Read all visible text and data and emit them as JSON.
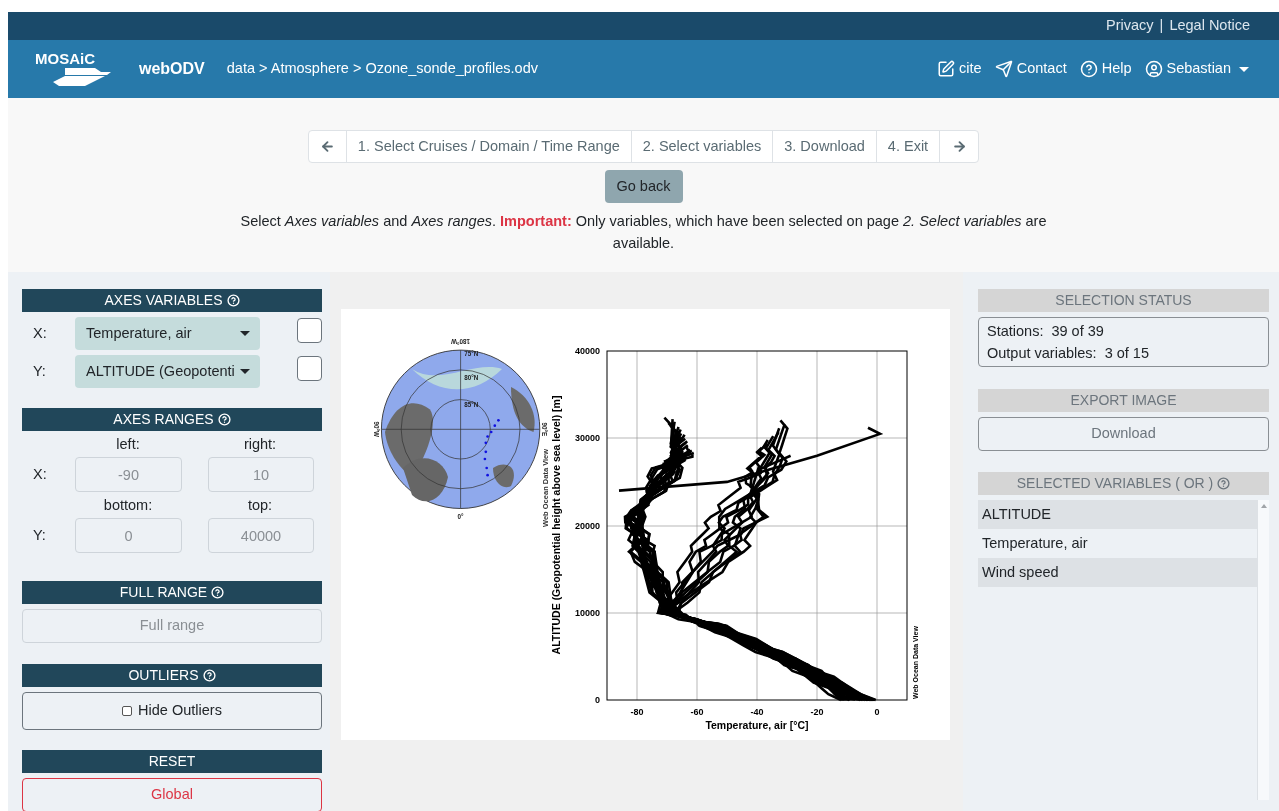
{
  "top_links": {
    "privacy": "Privacy",
    "separator": "|",
    "legal": "Legal Notice"
  },
  "brand": {
    "logo": "MOSAiC",
    "app": "webODV"
  },
  "breadcrumb": "data > Atmosphere > Ozone_sonde_profiles.odv",
  "nav": [
    {
      "kind": "cite",
      "label": "cite"
    },
    {
      "kind": "contact",
      "label": "Contact"
    },
    {
      "kind": "help",
      "label": "Help"
    },
    {
      "kind": "user",
      "label": "Sebastian"
    }
  ],
  "steps": [
    {
      "label": "1. Select Cruises / Domain / Time Range",
      "selected": false
    },
    {
      "label": "2. Select variables",
      "selected": false
    },
    {
      "label": "3. Download",
      "selected": false
    },
    {
      "label": "4. Exit",
      "selected": false
    }
  ],
  "go_back": "Go back",
  "instructions": "Select *Axes variables* and *Axes ranges*. **Important:** Only variables, which have been selected on page *2. Select variables* are available.",
  "axes_variables": {
    "title": "AXES VARIABLES",
    "rows": [
      {
        "axis": "X:",
        "value": "Temperature, air",
        "checked": false
      },
      {
        "axis": "Y:",
        "value": "ALTITUDE (Geopotenti",
        "checked": false
      }
    ]
  },
  "axes_ranges": {
    "title": "AXES RANGES",
    "col_labels": [
      [
        "left:",
        "right:"
      ],
      [
        "bottom:",
        "top:"
      ]
    ],
    "rows": [
      {
        "axis": "X:",
        "min": "-90",
        "max": "10"
      },
      {
        "axis": "Y:",
        "min": "0",
        "max": "40000"
      }
    ]
  },
  "full_range": {
    "title": "FULL RANGE",
    "button": "Full range"
  },
  "outliers": {
    "title": "OUTLIERS",
    "label": "Hide Outliers",
    "checked": false
  },
  "reset": {
    "title": "RESET",
    "button": "Global"
  },
  "map": {
    "labels": [
      "180°W",
      "75°N",
      "80°N",
      "85°N",
      "90°W",
      "90°E",
      "0°"
    ],
    "credit": "Web Ocean Data View"
  },
  "plot": {
    "xlabel": "Temperature, air [°C]",
    "ylabel": "ALTITUDE (Geopotential height above sea level) [m]",
    "xticks": [
      "-80",
      "-60",
      "-40",
      "-20",
      "0"
    ],
    "yticks": [
      "40000",
      "30000",
      "20000",
      "10000",
      "0"
    ],
    "credit": "Web Ocean Data View"
  },
  "selection_status": {
    "title": "SELECTION STATUS",
    "rows": [
      {
        "label": "Stations:",
        "value": "39 of 39"
      },
      {
        "label": "Output variables:",
        "value": "3 of 15"
      }
    ]
  },
  "export_image": {
    "title": "EXPORT IMAGE",
    "button": "Download"
  },
  "selected_variables": {
    "title": "SELECTED VARIABLES ( OR )",
    "items": [
      "ALTITUDE",
      "Temperature, air",
      "Wind speed"
    ]
  }
}
